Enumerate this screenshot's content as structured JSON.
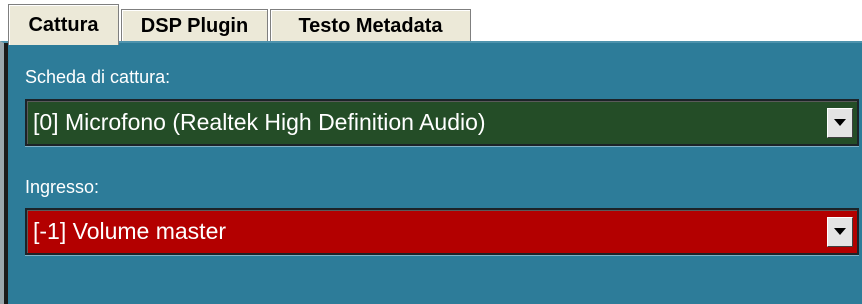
{
  "tabs": [
    {
      "label": "Cattura",
      "selected": true
    },
    {
      "label": "DSP Plugin",
      "selected": false
    },
    {
      "label": "Testo Metadata",
      "selected": false
    }
  ],
  "capture": {
    "device_label": "Scheda di cattura:",
    "device_value": "[0] Microfono (Realtek High Definition Audio)",
    "input_label": "Ingresso:",
    "input_value": "[-1] Volume master"
  },
  "colors": {
    "panel_background": "#2d7c99",
    "device_combo_background": "#244d27",
    "input_combo_background": "#b30000",
    "tab_background": "#ece9d8"
  },
  "icons": {
    "dropdown": "chevron-down-icon"
  }
}
